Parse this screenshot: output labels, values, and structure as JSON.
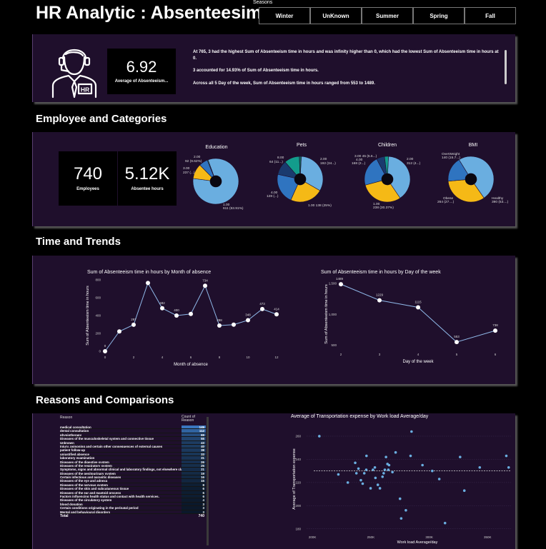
{
  "header": {
    "title": "HR Analytic : Absenteesim",
    "slicer_label": "Seasons",
    "seasons": [
      "Winter",
      "UnKnown",
      "Summer",
      "Spring",
      "Fall"
    ]
  },
  "summary": {
    "avg_value": "6.92",
    "avg_label": "Average of Absenteeism...",
    "icon_text": "HR",
    "insights": [
      "At 765, 3 had the highest Sum of Absenteeism time in hours and was infinity higher than 0, which had the lowest Sum of Absenteeism time in hours at 0.",
      "3 accounted for 14.93% of Sum of Absenteeism time in hours.",
      "Across all 5 Day of the week, Sum of Absenteeism time in hours ranged from 553 to 1489."
    ]
  },
  "sections": {
    "employee": "Employee and Categories",
    "time": "Time and Trends",
    "reasons": "Reasons and Comparisons"
  },
  "kpis": {
    "employees_value": "740",
    "employees_label": "Employees",
    "absentee_value": "5.12K",
    "absentee_label": "Absentee hours"
  },
  "colors": {
    "background": "#000000",
    "panel": "#1f0f2c",
    "pie_light": "#6aaee0",
    "pie_yellow": "#f5b916",
    "pie_blue": "#2f74c0",
    "pie_dark": "#1a3a6e",
    "pie_teal": "#139c8c",
    "line": "#8fb8e8"
  },
  "pies": [
    {
      "title": "Education",
      "slices": [
        {
          "label": "1.00",
          "value": 611,
          "color": "#6aaee0"
        },
        {
          "label": "3.00",
          "value": 79,
          "color": "#f5b916"
        },
        {
          "label": "2.00",
          "value": 46,
          "color": "#2f74c0"
        },
        {
          "label": "4.00",
          "value": 4,
          "color": "#139c8c"
        }
      ],
      "labels": [
        "2.00",
        "92 (9.62%)",
        "3.00",
        "237 (...)",
        "1.00",
        "611 (63.91%)"
      ]
    },
    {
      "title": "Pets",
      "slices": [
        {
          "label": "0.00",
          "value": 192,
          "color": "#6aaee0"
        },
        {
          "label": "1.00",
          "value": 138,
          "color": "#f5b916"
        },
        {
          "label": "4.00",
          "value": 128,
          "color": "#2f74c0"
        },
        {
          "label": "2.00",
          "value": 60,
          "color": "#1a3a6e"
        },
        {
          "label": "5.00",
          "value": 64,
          "color": "#139c8c"
        },
        {
          "label": "8.00",
          "value": 8,
          "color": "#0f6a60"
        }
      ],
      "labels": [
        "8.00",
        "64 (11...)",
        "2.00",
        "192 (34...)",
        "4.00",
        "128 (...)",
        "1.00 138 (25%)"
      ]
    },
    {
      "title": "Children",
      "slices": [
        {
          "label": "2.00",
          "value": 312,
          "color": "#6aaee0"
        },
        {
          "label": "1.00",
          "value": 238,
          "color": "#f5b916"
        },
        {
          "label": "0.00",
          "value": 168,
          "color": "#2f74c0"
        },
        {
          "label": "3.00",
          "value": 45,
          "color": "#1a3a6e"
        },
        {
          "label": "4.00",
          "value": 22,
          "color": "#139c8c"
        }
      ],
      "labels": [
        "3.00 45 (5.6...)",
        "4.00",
        "168 (2...)",
        "2.00",
        "312 (4...)",
        "1.00",
        "238 (30.37%)"
      ]
    },
    {
      "title": "BMI",
      "slices": [
        {
          "label": "Healthy",
          "value": 390,
          "color": "#6aaee0"
        },
        {
          "label": "Obese",
          "value": 264,
          "color": "#f5b916"
        },
        {
          "label": "OverWeight",
          "value": 140,
          "color": "#2f74c0"
        }
      ],
      "labels": [
        "OverWeight",
        "140 (15.7...)",
        "Obese",
        "264 (27....)",
        "Healthy",
        "390 (53....)"
      ]
    }
  ],
  "chart_data": [
    {
      "type": "line",
      "title": "Sum of Absenteeism time in hours by Month of absence",
      "xlabel": "Month of absence",
      "ylabel": "Sum of Absenteeism time in hours",
      "x": [
        0,
        1,
        2,
        3,
        4,
        5,
        6,
        7,
        8,
        9,
        10,
        11,
        12
      ],
      "y": [
        0,
        222,
        297,
        765,
        482,
        400,
        418,
        734,
        288,
        298,
        348,
        473,
        414
      ],
      "data_labels": [
        "0",
        "",
        "297",
        "",
        "482",
        "400",
        "",
        "734",
        "288",
        "",
        "348",
        "473",
        "414"
      ],
      "xticks": [
        "0",
        "2",
        "4",
        "6",
        "8",
        "10",
        "12"
      ],
      "yticks": [
        "0",
        "200",
        "400",
        "600",
        "800"
      ],
      "xlim": [
        0,
        12
      ],
      "ylim": [
        0,
        800
      ]
    },
    {
      "type": "line",
      "title": "Sum of Absenteeism time in hours by Day of the week",
      "xlabel": "Day of the week",
      "ylabel": "Sum of Absenteeism time in hours",
      "x": [
        2,
        3,
        4,
        5,
        6
      ],
      "y": [
        1489,
        1229,
        1115,
        553,
        738
      ],
      "data_labels": [
        "1489",
        "1229",
        "1115",
        "553",
        "738"
      ],
      "xticks": [
        "2",
        "3",
        "4",
        "5",
        "6"
      ],
      "yticks": [
        "500",
        "1,000",
        "1,500"
      ],
      "xlim": [
        2,
        6
      ],
      "ylim": [
        450,
        1560
      ]
    },
    {
      "type": "scatter",
      "title": "Average of Transportation expense by Work load Average/day",
      "xlabel": "Work load Average/day",
      "ylabel": "Average of Transportation expense",
      "xticks": [
        "200K",
        "250K",
        "300K",
        "350K"
      ],
      "yticks": [
        "180",
        "200",
        "220",
        "240",
        "260"
      ],
      "xlim": [
        195000,
        370000
      ],
      "ylim": [
        178,
        268
      ],
      "trend_y": 230,
      "x": [
        205917,
        222196,
        230290,
        236629,
        237656,
        239409,
        241476,
        243006,
        244387,
        246074,
        246288,
        249797,
        251818,
        253465,
        253957,
        256000,
        257800,
        260000,
        261000,
        262000,
        263000,
        264249,
        265017,
        265615,
        268519,
        271219,
        275000,
        276000,
        280000,
        284031,
        284853,
        294217,
        302585,
        308593,
        313532,
        326452,
        330061,
        343253,
        366000,
        368000
      ],
      "y": [
        260,
        227,
        220,
        237,
        228,
        232,
        222,
        219,
        228,
        231,
        243,
        215,
        231,
        233,
        224,
        218,
        215,
        225,
        228,
        231,
        242,
        236,
        231,
        235,
        229,
        246,
        206,
        189,
        196,
        243,
        264,
        235,
        230,
        223,
        185,
        242,
        213,
        233,
        243,
        233
      ]
    }
  ],
  "reasons_table": {
    "col_reason": "Reason",
    "col_count": "Count of Reason",
    "rows": [
      {
        "reason": "medical consultation",
        "count": 149
      },
      {
        "reason": "dental consultation",
        "count": 112
      },
      {
        "reason": "physiotherapy",
        "count": 69
      },
      {
        "reason": "Diseases of the musculoskeletal system and connective tissue",
        "count": 55
      },
      {
        "reason": "Unknown",
        "count": 43
      },
      {
        "reason": "Injury, poisoning and certain other consequences of external causes",
        "count": 40
      },
      {
        "reason": "patient follow-up",
        "count": 38
      },
      {
        "reason": "unjustified absence",
        "count": 33
      },
      {
        "reason": "laboratory examination",
        "count": 31
      },
      {
        "reason": "Diseases of the digestive system",
        "count": 26
      },
      {
        "reason": "Diseases of the respiratory system",
        "count": 25
      },
      {
        "reason": "Symptoms, signs and abnormal clinical and laboratory findings, not elsewhere classified",
        "count": 21
      },
      {
        "reason": "Diseases of the genitourinary system",
        "count": 19
      },
      {
        "reason": "Certain infectious and parasitic diseases",
        "count": 16
      },
      {
        "reason": "Diseases of the eye and adnexa",
        "count": 15
      },
      {
        "reason": "Diseases of the nervous system",
        "count": 8
      },
      {
        "reason": "Diseases of the skin and subcutaneous tissue",
        "count": 6
      },
      {
        "reason": "Diseases of the ear and mastoid process",
        "count": 6
      },
      {
        "reason": "Factors influencing health status and contact with health services.",
        "count": 6
      },
      {
        "reason": "Diseases of the circulatory system",
        "count": 4
      },
      {
        "reason": "blood donation",
        "count": 3
      },
      {
        "reason": "Certain conditions originating in the perinatal period",
        "count": 3
      },
      {
        "reason": "Mental and behavioural disorders",
        "count": 3
      }
    ],
    "total_label": "Total",
    "total_value": "740"
  }
}
